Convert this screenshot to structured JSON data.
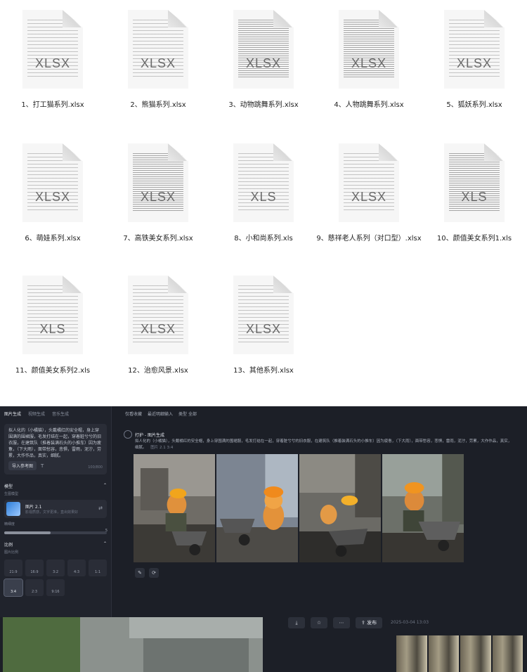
{
  "files": [
    {
      "name": "1、打工猫系列.xlsx",
      "type": "XLSX"
    },
    {
      "name": "2、熊猫系列.xlsx",
      "type": "XLSX"
    },
    {
      "name": "3、动物跳舞系列.xlsx",
      "type": "XLSX"
    },
    {
      "name": "4、人物跳舞系列.xlsx",
      "type": "XLSX"
    },
    {
      "name": "5、狐妖系列.xlsx",
      "type": "XLSX"
    },
    {
      "name": "6、萌娃系列.xlsx",
      "type": "XLSX"
    },
    {
      "name": "7、高铁美女系列.xlsx",
      "type": "XLSX"
    },
    {
      "name": "8、小和尚系列.xls",
      "type": "XLS"
    },
    {
      "name": "9、慈祥老人系列（对口型）.xlsx",
      "type": "XLSX"
    },
    {
      "name": "10、颜值美女系列1.xls",
      "type": "XLS"
    },
    {
      "name": "11、颜值美女系列2.xls",
      "type": "XLS"
    },
    {
      "name": "12、治愈风景.xlsx",
      "type": "XLSX"
    },
    {
      "name": "13、其他系列.xlsx",
      "type": "XLSX"
    }
  ],
  "app": {
    "tabs": [
      "图片生成",
      "视频生成",
      "音乐生成"
    ],
    "prompt": "拟人化的（小橘猫），头戴橘红的安全帽，身上穿围满的围裙服，毛发打结在一起，穿着脏兮兮的旧衣服，在建筑队（推着装满石头的小推车）因为疲惫，（下大雨），面带愁容，悲惧，雷雨，泥泞，劳累，大作作品，真实，细腻。",
    "ref_button": "导入参考图",
    "char_count": "100/800",
    "model_section": "模型",
    "model_sub": "生图模型",
    "model_name": "图片 2.1",
    "model_desc": "影视质感，文字更准，直出效果好",
    "fine_label": "精细度",
    "fine_value": "5",
    "ratio_section": "比例",
    "ratio_sub": "图片比例",
    "ratios": [
      "21:9",
      "16:9",
      "3:2",
      "4:3",
      "1:1",
      "3:4",
      "2:3",
      "9:16"
    ],
    "top_tools": [
      "仅看收藏",
      "最近明细输入",
      "类型 全部"
    ],
    "gen_title": "打护 - 图片生成",
    "gen_prompt": "拟人化的（小橘猫），头戴橘红的安全帽，身上穿围满的围裙服，毛发打结在一起，穿着脏兮兮的旧衣服，在建筑队（推着装满石头的小推车）因为疲惫，（下大雨），面带愁容，悲惧，雷雨，泥泞，劳累，大作作品，真实，细腻。",
    "gen_meta": "图片 2.1   3:4",
    "publish": "发布",
    "timestamp": "2025-03-04 13:03",
    "colors": {
      "bg": "#1c1f27",
      "panel": "#20232c",
      "card": "#2a2d37"
    }
  }
}
